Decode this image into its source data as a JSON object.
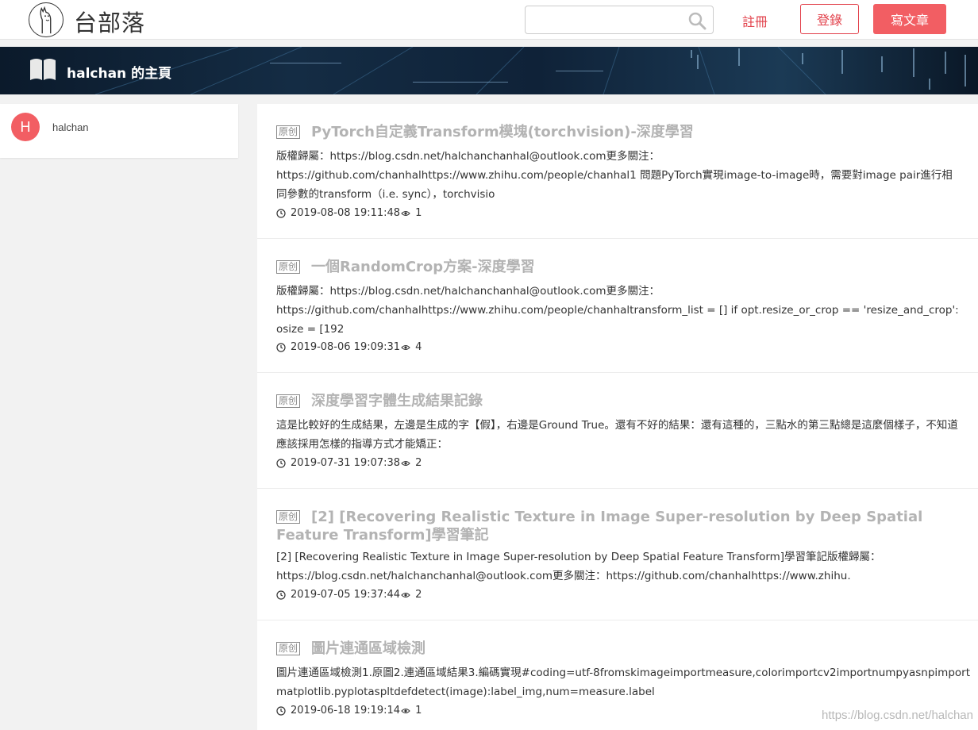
{
  "header": {
    "site_name": "台部落",
    "search": {
      "value": "",
      "placeholder": ""
    },
    "register_label": "註冊",
    "login_label": "登錄",
    "write_label": "寫文章"
  },
  "banner": {
    "title": "halchan 的主頁"
  },
  "sidebar": {
    "avatar_letter": "H",
    "username": "halchan"
  },
  "articles": [
    {
      "badge": "原创",
      "title": "PyTorch自定義Transform模塊(torchvision)-深度學習",
      "summary": "版權歸屬：https://blog.csdn.net/halchanchanhal@outlook.com更多關注：https://github.com/chanhalhttps://www.zhihu.com/people/chanhal1 問題PyTorch實現image-to-image時，需要對image pair進行相同參數的transform（i.e. sync），torchvisio",
      "date": "2019-08-08 19:11:48",
      "views": "1"
    },
    {
      "badge": "原创",
      "title": "一個RandomCrop方案-深度學習",
      "summary": "版權歸屬：https://blog.csdn.net/halchanchanhal@outlook.com更多關注：https://github.com/chanhalhttps://www.zhihu.com/people/chanhaltransform_list = [] if opt.resize_or_crop == 'resize_and_crop': osize = [192",
      "date": "2019-08-06 19:09:31",
      "views": "4"
    },
    {
      "badge": "原创",
      "title": "深度學習字體生成結果記錄",
      "summary": "這是比較好的生成結果，左邊是生成的字【假】，右邊是Ground True。還有不好的結果：還有這種的，三點水的第三點總是這麼個樣子，不知道應該採用怎樣的指導方式才能矯正：",
      "date": "2019-07-31 19:07:38",
      "views": "2"
    },
    {
      "badge": "原创",
      "title": "[2] [Recovering Realistic Texture in Image Super-resolution by Deep Spatial Feature Transform]學習筆記",
      "summary": "[2] [Recovering Realistic Texture in Image Super-resolution by Deep Spatial Feature Transform]學習筆記版權歸屬：https://blog.csdn.net/halchanchanhal@outlook.com更多關注：https://github.com/chanhalhttps://www.zhihu.",
      "date": "2019-07-05 19:37:44",
      "views": "2"
    },
    {
      "badge": "原创",
      "title": "圖片連通區域檢測",
      "summary": "圖片連通區域檢測1.原圖2.連通區域結果3.編碼實現#coding=utf-8fromskimageimportmeasure,colorimportcv2importnumpyasnpimportmatplotlib.pyplotaspltdefdetect(image):label_img,num=measure.label",
      "date": "2019-06-18 19:19:14",
      "views": "1"
    }
  ],
  "watermark": "https://blog.csdn.net/halchan",
  "colors": {
    "accent": "#e2414b",
    "write_button": "#f25e63",
    "title_gray": "#b3b3b3"
  }
}
